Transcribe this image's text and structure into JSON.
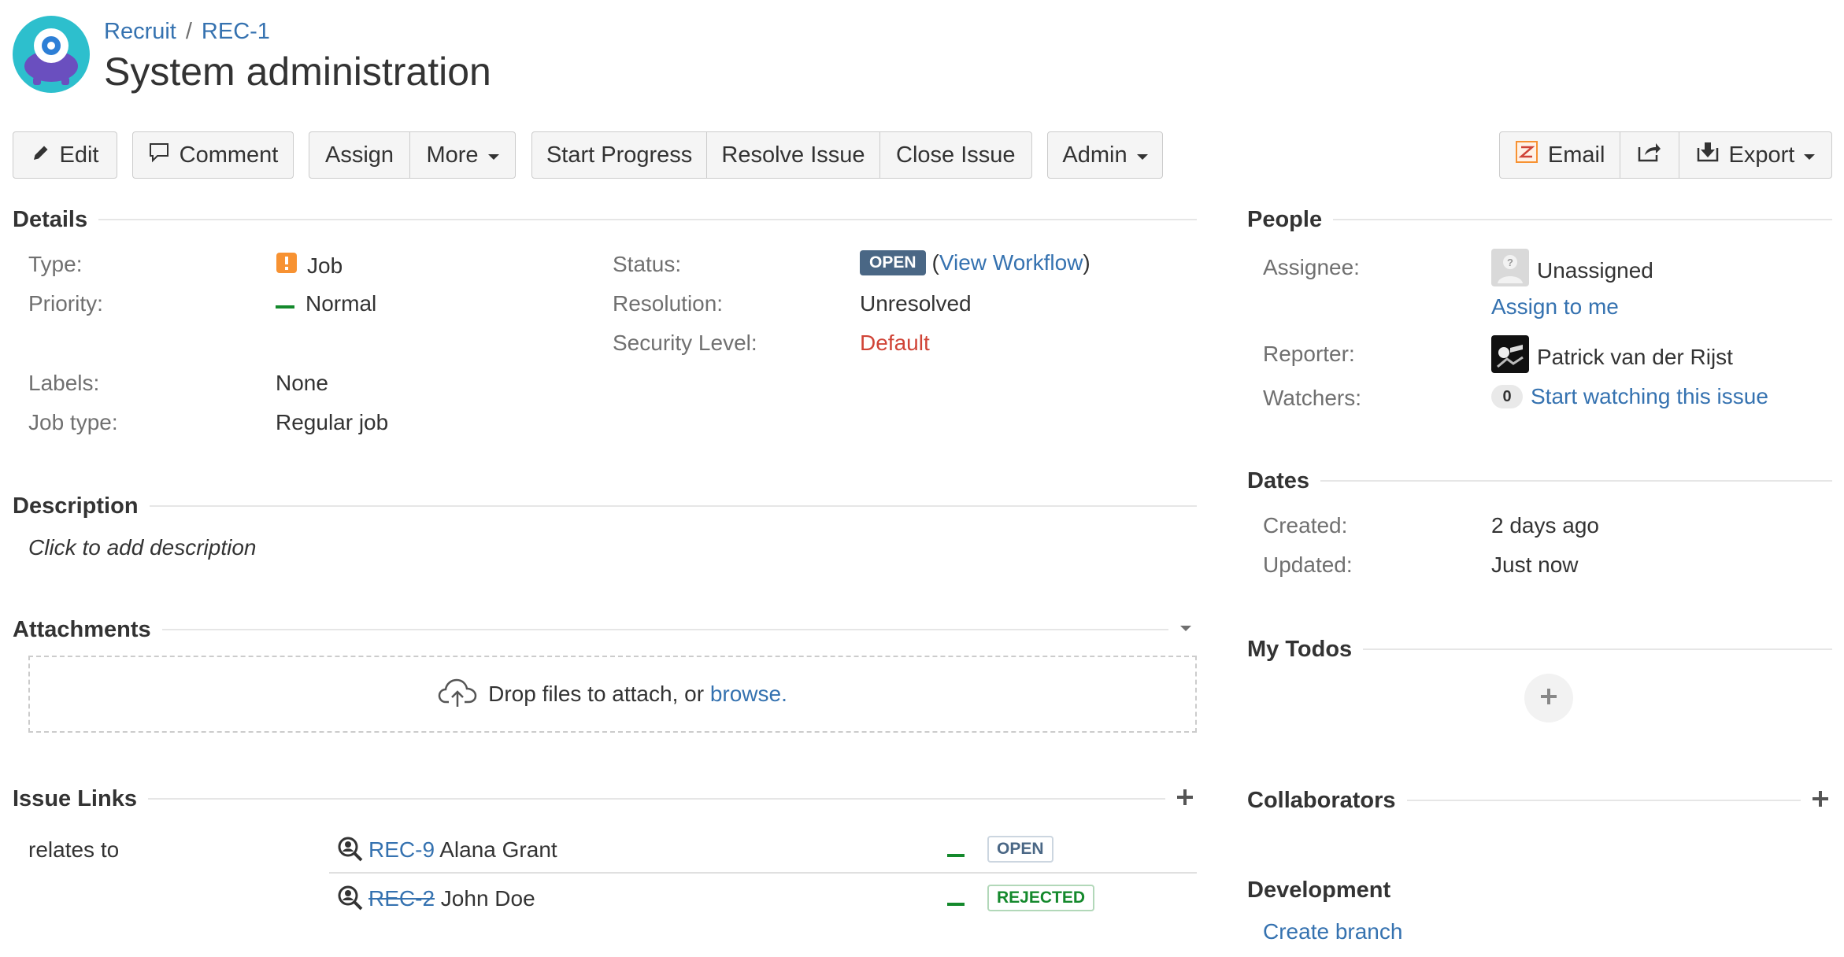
{
  "header": {
    "project_link": "Recruit",
    "separator": "/",
    "issue_key": "REC-1",
    "title": "System administration"
  },
  "toolbar": {
    "edit": "Edit",
    "comment": "Comment",
    "assign": "Assign",
    "more": "More",
    "start_progress": "Start Progress",
    "resolve_issue": "Resolve Issue",
    "close_issue": "Close Issue",
    "admin": "Admin",
    "email": "Email",
    "export": "Export"
  },
  "details": {
    "heading": "Details",
    "type_label": "Type:",
    "type_value": "Job",
    "priority_label": "Priority:",
    "priority_value": "Normal",
    "labels_label": "Labels:",
    "labels_value": "None",
    "job_type_label": "Job type:",
    "job_type_value": "Regular job",
    "status_label": "Status:",
    "status_value": "OPEN",
    "workflow_open": "(",
    "workflow_link": "View Workflow",
    "workflow_close": ")",
    "resolution_label": "Resolution:",
    "resolution_value": "Unresolved",
    "security_label": "Security Level:",
    "security_value": "Default"
  },
  "description": {
    "heading": "Description",
    "placeholder": "Click to add description"
  },
  "attachments": {
    "heading": "Attachments",
    "drop_text": "Drop files to attach, or",
    "browse_link": "browse."
  },
  "issue_links": {
    "heading": "Issue Links",
    "relation": "relates to",
    "links": [
      {
        "key": "REC-9",
        "summary": "Alana Grant",
        "status": "OPEN"
      },
      {
        "key": "REC-2",
        "summary": "John Doe",
        "status": "REJECTED"
      }
    ]
  },
  "people": {
    "heading": "People",
    "assignee_label": "Assignee:",
    "assignee_value": "Unassigned",
    "assign_to_me": "Assign to me",
    "reporter_label": "Reporter:",
    "reporter_value": "Patrick van der Rijst",
    "watchers_label": "Watchers:",
    "watchers_count": "0",
    "watch_link": "Start watching this issue"
  },
  "dates": {
    "heading": "Dates",
    "created_label": "Created:",
    "created_value": "2 days ago",
    "updated_label": "Updated:",
    "updated_value": "Just now"
  },
  "todos": {
    "heading": "My Todos"
  },
  "collaborators": {
    "heading": "Collaborators"
  },
  "development": {
    "heading": "Development",
    "create_branch": "Create branch"
  },
  "colors": {
    "link": "#3572b0",
    "status_open_bg": "#4a6785",
    "priority_normal": "#14892c",
    "job_type_icon": "#f79232",
    "security_default": "#d04437",
    "rejected": "#14892c"
  }
}
